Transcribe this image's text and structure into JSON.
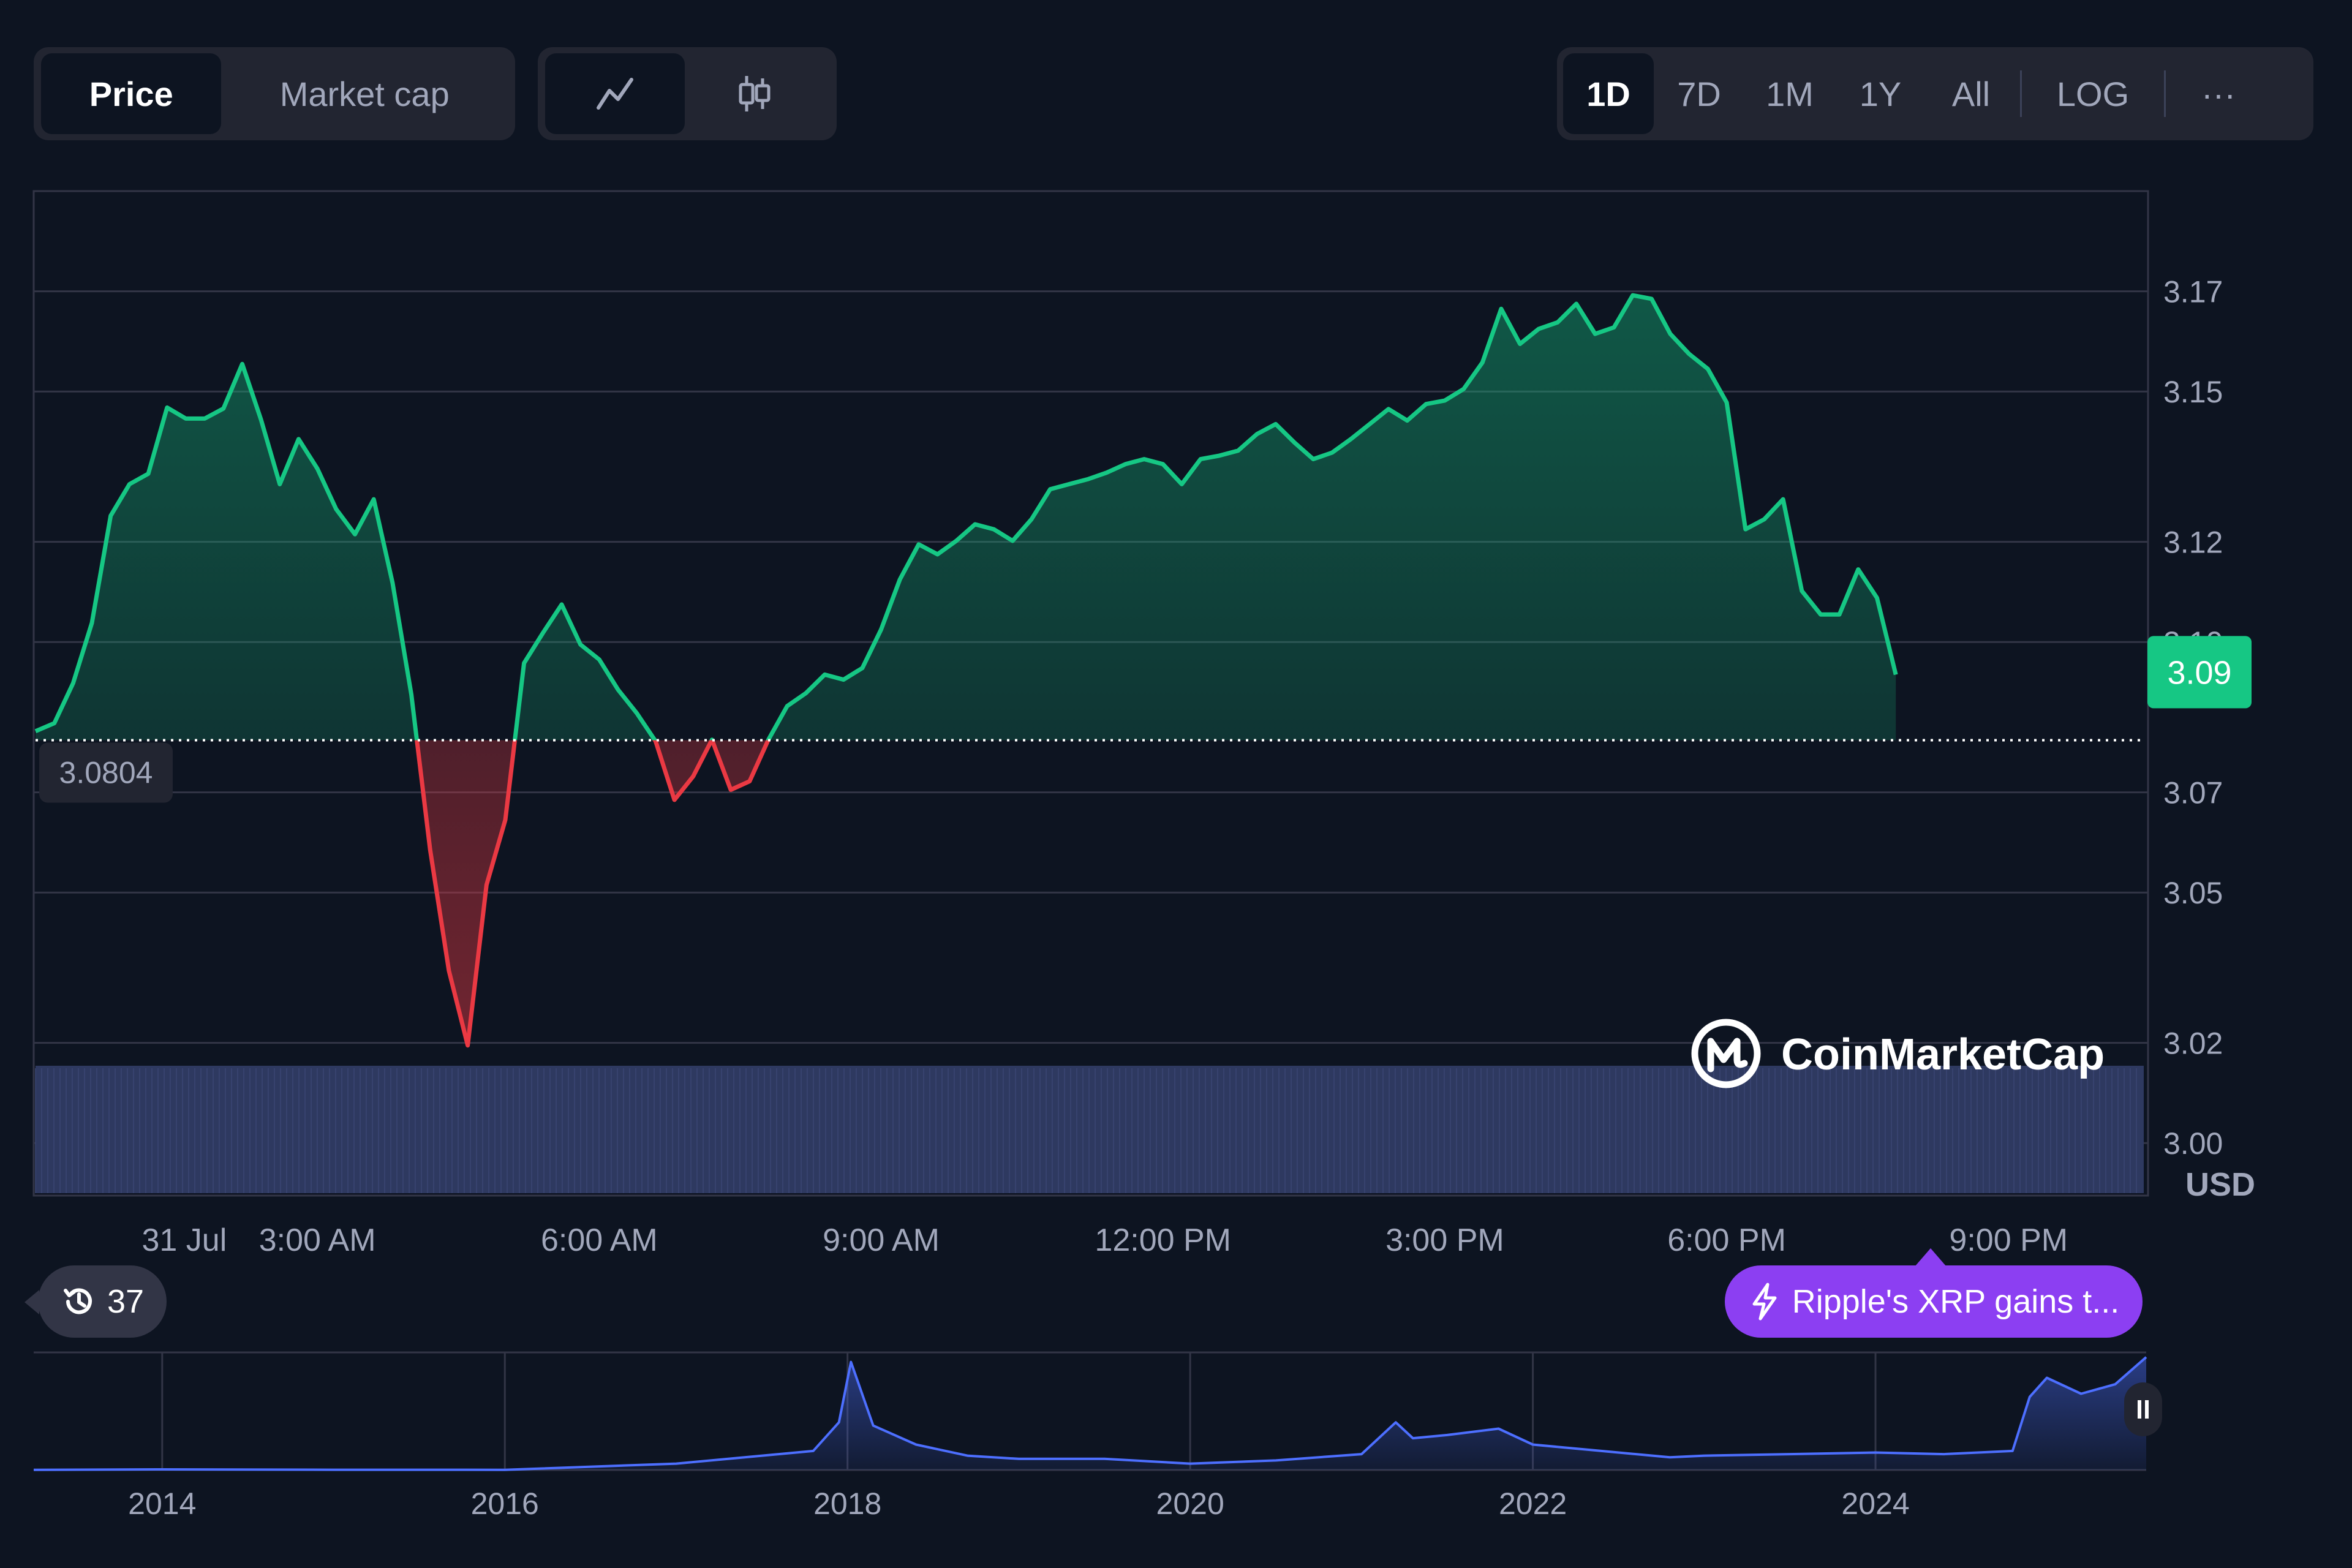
{
  "toolbar": {
    "price_label": "Price",
    "market_cap_label": "Market cap",
    "line_icon": "line-chart-icon",
    "candle_icon": "candlestick-icon",
    "ranges": [
      "1D",
      "7D",
      "1M",
      "1Y",
      "All"
    ],
    "active_range": "1D",
    "log_label": "LOG",
    "more_label": "···"
  },
  "colors": {
    "background": "#0d1421",
    "up": "#16c784",
    "down": "#ea3943",
    "volume": "#2e3960",
    "overview": "#4d6fff",
    "news": "#8c3ff2"
  },
  "chart_data": [
    {
      "type": "line",
      "title": "",
      "x": [
        "00:00",
        "00:12",
        "00:24",
        "00:36",
        "00:48",
        "01:00",
        "01:12",
        "01:24",
        "01:36",
        "01:48",
        "02:00",
        "02:12",
        "02:24",
        "02:36",
        "02:48",
        "03:00",
        "03:12",
        "03:24",
        "03:36",
        "03:48",
        "04:00",
        "04:12",
        "04:24",
        "04:36",
        "04:48",
        "05:00",
        "05:12",
        "05:24",
        "05:36",
        "05:48",
        "06:00",
        "06:12",
        "06:24",
        "06:36",
        "06:48",
        "07:00",
        "07:12",
        "07:24",
        "07:36",
        "07:48",
        "08:00",
        "08:12",
        "08:24",
        "08:36",
        "08:48",
        "09:00",
        "09:12",
        "09:24",
        "09:36",
        "09:48",
        "10:00",
        "10:12",
        "10:24",
        "10:36",
        "10:48",
        "11:00",
        "11:12",
        "11:24",
        "11:36",
        "11:48",
        "12:00",
        "12:12",
        "12:24",
        "12:36",
        "12:48",
        "13:00",
        "13:12",
        "13:24",
        "13:36",
        "13:48",
        "14:00",
        "14:12",
        "14:24",
        "14:36",
        "14:48",
        "15:00",
        "15:12",
        "15:24",
        "15:36",
        "15:48",
        "16:00",
        "16:12",
        "16:24",
        "16:36",
        "16:48",
        "17:00",
        "17:12",
        "17:24",
        "17:36",
        "17:48",
        "18:00",
        "18:12",
        "18:24",
        "18:36",
        "18:48",
        "19:00",
        "19:12",
        "19:24",
        "19:36",
        "19:48",
        "20:00",
        "20:12",
        "20:24",
        "20:36",
        "20:48",
        "21:00",
        "21:12",
        "21:24",
        "21:36",
        "21:48",
        "22:00",
        "22:12",
        "22:24"
      ],
      "values": [
        3.0822,
        3.0838,
        3.0918,
        3.1038,
        3.1252,
        3.1315,
        3.1336,
        3.1468,
        3.1446,
        3.1446,
        3.1466,
        3.1555,
        3.1444,
        3.1315,
        3.1405,
        3.1346,
        3.1265,
        3.1215,
        3.1285,
        3.1118,
        3.0895,
        3.0585,
        3.0344,
        3.0195,
        3.0515,
        3.0645,
        3.0958,
        3.1018,
        3.1075,
        3.0995,
        3.0965,
        3.0905,
        3.0858,
        3.0802,
        3.0685,
        3.0732,
        3.0805,
        3.0705,
        3.0722,
        3.0805,
        3.0872,
        3.0898,
        3.0935,
        3.0925,
        3.0948,
        3.1025,
        3.1125,
        3.1195,
        3.1175,
        3.1202,
        3.1235,
        3.1225,
        3.1202,
        3.1245,
        3.1305,
        3.1315,
        3.1325,
        3.1338,
        3.1355,
        3.1365,
        3.1355,
        3.1315,
        3.1365,
        3.1372,
        3.1382,
        3.1415,
        3.1435,
        3.1398,
        3.1365,
        3.1378,
        3.1405,
        3.1435,
        3.1465,
        3.1442,
        3.1475,
        3.1482,
        3.1505,
        3.1558,
        3.1665,
        3.1595,
        3.1625,
        3.1638,
        3.1675,
        3.1615,
        3.1628,
        3.1692,
        3.1685,
        3.1615,
        3.1575,
        3.1545,
        3.1478,
        3.1225,
        3.1245,
        3.1285,
        3.1102,
        3.1055,
        3.1055,
        3.1145,
        3.1088,
        3.0935
      ],
      "baseline": 3.0804,
      "baseline_label": "3.0804",
      "current_price": "3.09",
      "yticks": [
        "3.17",
        "3.15",
        "3.12",
        "3.10",
        "3.07",
        "3.05",
        "3.02",
        "3.00"
      ],
      "ylim": [
        2.99,
        3.19
      ],
      "xticks": [
        {
          "time": "01:35",
          "label": "31 Jul"
        },
        {
          "time": "03:00",
          "label": "3:00 AM"
        },
        {
          "time": "06:00",
          "label": "6:00 AM"
        },
        {
          "time": "09:00",
          "label": "9:00 AM"
        },
        {
          "time": "12:00",
          "label": "12:00 PM"
        },
        {
          "time": "15:00",
          "label": "3:00 PM"
        },
        {
          "time": "18:00",
          "label": "6:00 PM"
        },
        {
          "time": "21:00",
          "label": "9:00 PM"
        }
      ],
      "unit": "USD",
      "grid": true
    },
    {
      "type": "area",
      "title": "",
      "x": [
        2013.25,
        2014,
        2015,
        2016,
        2017,
        2017.4,
        2017.8,
        2017.95,
        2018.02,
        2018.15,
        2018.4,
        2018.7,
        2019,
        2019.5,
        2020,
        2020.5,
        2021,
        2021.2,
        2021.3,
        2021.5,
        2021.8,
        2022,
        2022.4,
        2022.8,
        2023,
        2023.5,
        2024,
        2024.4,
        2024.8,
        2024.9,
        2025,
        2025.2,
        2025.4,
        2025.58
      ],
      "values": [
        0.005,
        0.02,
        0.008,
        0.006,
        0.2,
        0.4,
        0.6,
        1.5,
        3.4,
        1.4,
        0.8,
        0.45,
        0.35,
        0.35,
        0.2,
        0.3,
        0.5,
        1.5,
        1.0,
        1.1,
        1.3,
        0.8,
        0.6,
        0.4,
        0.45,
        0.5,
        0.55,
        0.5,
        0.6,
        2.3,
        2.9,
        2.4,
        2.7,
        3.55
      ],
      "xticks": [
        "2014",
        "2016",
        "2018",
        "2020",
        "2022",
        "2024"
      ],
      "ylim": [
        0,
        3.7
      ]
    }
  ],
  "watermark": "CoinMarketCap",
  "history_count": "37",
  "news_label": "Ripple's XRP gains t...",
  "pause_icon": "pause-icon"
}
